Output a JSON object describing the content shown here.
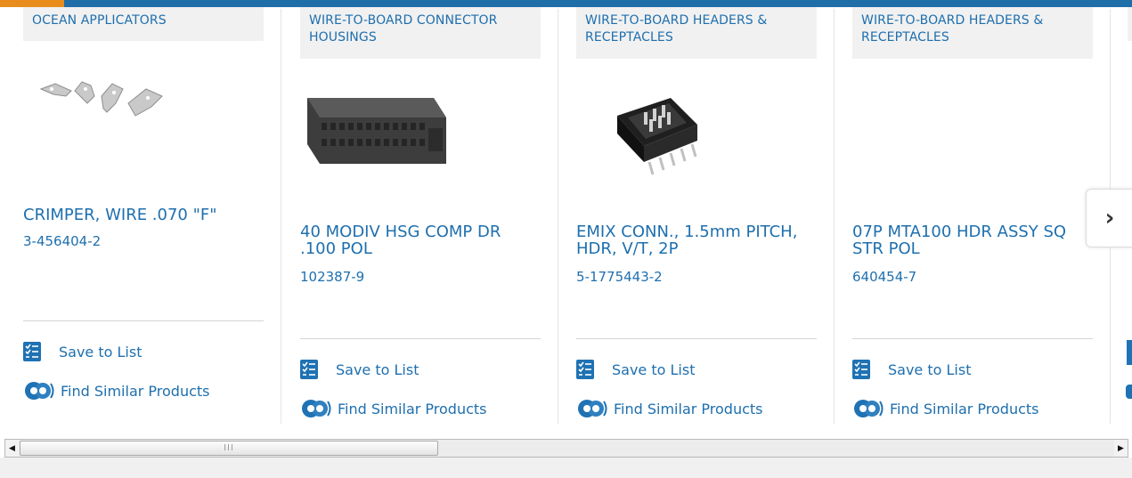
{
  "products": [
    {
      "category": "OCEAN APPLICATORS",
      "title": "CRIMPER, WIRE .070 \"F\"",
      "part_number": "3-456404-2",
      "save_label": "Save to List",
      "similar_label": "Find Similar Products",
      "image": "crimper-pieces"
    },
    {
      "category": "WIRE-TO-BOARD CONNECTOR HOUSINGS",
      "title": "40 MODIV HSG COMP DR .100 POL",
      "part_number": "102387-9",
      "save_label": "Save to List",
      "similar_label": "Find Similar Products",
      "image": "connector-housing"
    },
    {
      "category": "WIRE-TO-BOARD HEADERS & RECEPTACLES",
      "title": "EMIX CONN., 1.5mm PITCH, HDR, V/T, 2P",
      "part_number": "5-1775443-2",
      "save_label": "Save to List",
      "similar_label": "Find Similar Products",
      "image": "header-connector"
    },
    {
      "category": "WIRE-TO-BOARD HEADERS & RECEPTACLES",
      "title": "07P MTA100 HDR ASSY SQ STR POL",
      "part_number": "640454-7",
      "save_label": "Save to List",
      "similar_label": "Find Similar Products",
      "image": "none"
    }
  ],
  "carousel": {
    "next_icon": "chevron-right-icon",
    "next_glyph": "›"
  },
  "scrollbar": {
    "left_glyph": "◀",
    "right_glyph": "▶",
    "thumb_grip": "III"
  },
  "colors": {
    "brand_blue": "#1e6fae",
    "accent_orange": "#e88d1c",
    "category_bg": "#f1f1f1"
  }
}
